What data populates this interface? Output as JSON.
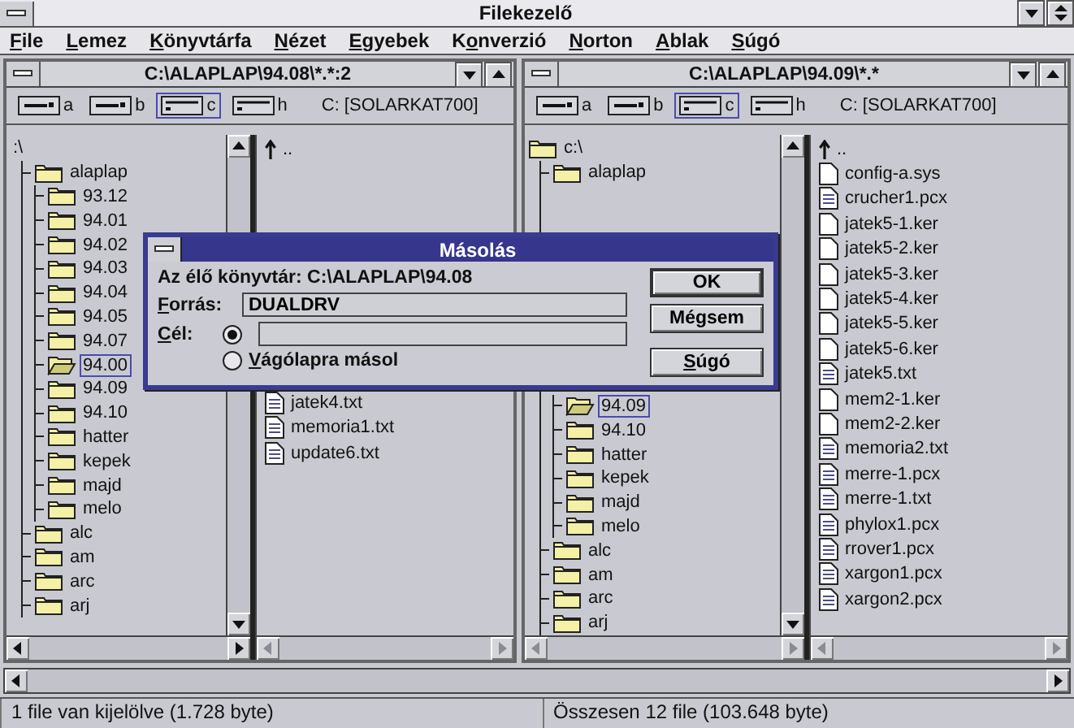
{
  "window": {
    "title": "Filekezelő"
  },
  "menu": [
    {
      "key": "F",
      "after": "ile"
    },
    {
      "key": "L",
      "after": "emez"
    },
    {
      "key": "K",
      "after": "önyvtárfa"
    },
    {
      "key": "N",
      "after": "ézet"
    },
    {
      "key": "E",
      "after": "gyebek"
    },
    {
      "before": "K",
      "key": "o",
      "after": "nverzió"
    },
    {
      "key": "N",
      "after": "orton"
    },
    {
      "key": "A",
      "after": "blak"
    },
    {
      "key": "S",
      "after": "úgó"
    }
  ],
  "panes": [
    {
      "title": "C:\\ALAPLAP\\94.08\\*.*:2",
      "volume": "C: [SOLARKAT700]",
      "drives": [
        {
          "letter": "a",
          "kind": "floppy",
          "selected": false
        },
        {
          "letter": "b",
          "kind": "floppy",
          "selected": false
        },
        {
          "letter": "c",
          "kind": "hdd",
          "selected": true
        },
        {
          "letter": "h",
          "kind": "hdd",
          "selected": false
        }
      ],
      "tree": [
        {
          "name": ":\\",
          "kind": "label",
          "selected": false,
          "children": [
            {
              "name": "alaplap",
              "kind": "folder",
              "selected": false,
              "children": [
                {
                  "name": "93.12",
                  "kind": "folder",
                  "selected": false
                },
                {
                  "name": "94.01",
                  "kind": "folder",
                  "selected": false
                },
                {
                  "name": "94.02",
                  "kind": "folder",
                  "selected": false
                },
                {
                  "name": "94.03",
                  "kind": "folder",
                  "selected": false
                },
                {
                  "name": "94.04",
                  "kind": "folder",
                  "selected": false
                },
                {
                  "name": "94.05",
                  "kind": "folder",
                  "selected": false
                },
                {
                  "name": "94.07",
                  "kind": "folder",
                  "selected": false
                },
                {
                  "name": "94.00",
                  "kind": "folder",
                  "selected": true
                },
                {
                  "name": "94.09",
                  "kind": "folder",
                  "selected": false
                },
                {
                  "name": "94.10",
                  "kind": "folder",
                  "selected": false
                },
                {
                  "name": "hatter",
                  "kind": "folder",
                  "selected": false
                },
                {
                  "name": "kepek",
                  "kind": "folder",
                  "selected": false
                },
                {
                  "name": "majd",
                  "kind": "folder",
                  "selected": false
                },
                {
                  "name": "melo",
                  "kind": "folder",
                  "selected": false
                }
              ]
            },
            {
              "name": "alc",
              "kind": "folder",
              "selected": false
            },
            {
              "name": "am",
              "kind": "folder",
              "selected": false
            },
            {
              "name": "arc",
              "kind": "folder",
              "selected": false
            },
            {
              "name": "arj",
              "kind": "folder",
              "selected": false
            }
          ]
        }
      ],
      "files": [
        {
          "name": "..",
          "kind": "parent",
          "selected": false
        },
        {
          "name": "jatek4.txt",
          "kind": "text",
          "selected": false
        },
        {
          "name": "memoria1.txt",
          "kind": "text",
          "selected": false
        },
        {
          "name": "update6.txt",
          "kind": "text",
          "selected": false
        }
      ]
    },
    {
      "title": "C:\\ALAPLAP\\94.09\\*.*",
      "volume": "C: [SOLARKAT700]",
      "drives": [
        {
          "letter": "a",
          "kind": "floppy",
          "selected": false
        },
        {
          "letter": "b",
          "kind": "floppy",
          "selected": false
        },
        {
          "letter": "c",
          "kind": "hdd",
          "selected": true
        },
        {
          "letter": "h",
          "kind": "hdd",
          "selected": false
        }
      ],
      "tree": [
        {
          "name": "c:\\",
          "kind": "folder",
          "selected": false,
          "children": [
            {
              "name": "alaplap",
              "kind": "folder",
              "selected": false,
              "children": [
                {
                  "name": "94.09",
                  "kind": "folder",
                  "selected": true
                },
                {
                  "name": "94.10",
                  "kind": "folder",
                  "selected": false
                },
                {
                  "name": "hatter",
                  "kind": "folder",
                  "selected": false
                },
                {
                  "name": "kepek",
                  "kind": "folder",
                  "selected": false
                },
                {
                  "name": "majd",
                  "kind": "folder",
                  "selected": false
                },
                {
                  "name": "melo",
                  "kind": "folder",
                  "selected": false
                }
              ]
            },
            {
              "name": "alc",
              "kind": "folder",
              "selected": false
            },
            {
              "name": "am",
              "kind": "folder",
              "selected": false
            },
            {
              "name": "arc",
              "kind": "folder",
              "selected": false
            },
            {
              "name": "arj",
              "kind": "folder",
              "selected": false
            }
          ]
        }
      ],
      "files": [
        {
          "name": "..",
          "kind": "parent",
          "selected": false
        },
        {
          "name": "config-a.sys",
          "kind": "blank",
          "selected": false
        },
        {
          "name": "crucher1.pcx",
          "kind": "text",
          "selected": false
        },
        {
          "name": "jatek5-1.ker",
          "kind": "blank",
          "selected": false
        },
        {
          "name": "jatek5-2.ker",
          "kind": "blank",
          "selected": false
        },
        {
          "name": "jatek5-3.ker",
          "kind": "blank",
          "selected": false
        },
        {
          "name": "jatek5-4.ker",
          "kind": "blank",
          "selected": false
        },
        {
          "name": "jatek5-5.ker",
          "kind": "blank",
          "selected": false
        },
        {
          "name": "jatek5-6.ker",
          "kind": "blank",
          "selected": false
        },
        {
          "name": "jatek5.txt",
          "kind": "text",
          "selected": false
        },
        {
          "name": "mem2-1.ker",
          "kind": "blank",
          "selected": false
        },
        {
          "name": "mem2-2.ker",
          "kind": "blank",
          "selected": false
        },
        {
          "name": "memoria2.txt",
          "kind": "text",
          "selected": false
        },
        {
          "name": "merre-1.pcx",
          "kind": "text",
          "selected": false
        },
        {
          "name": "merre-1.txt",
          "kind": "text",
          "selected": false
        },
        {
          "name": "phylox1.pcx",
          "kind": "text",
          "selected": false
        },
        {
          "name": "rrover1.pcx",
          "kind": "text",
          "selected": false
        },
        {
          "name": "xargon1.pcx",
          "kind": "text",
          "selected": false
        },
        {
          "name": "xargon2.pcx",
          "kind": "text",
          "selected": false
        }
      ]
    }
  ],
  "dialog": {
    "title": "Másolás",
    "current_dir": "Az élő könyvtár: C:\\ALAPLAP\\94.08",
    "source": {
      "label": {
        "key": "F",
        "after": "orrás:"
      },
      "value": "DUALDRV"
    },
    "target": {
      "label": {
        "key": "C",
        "after": "él:"
      },
      "selected": true
    },
    "clipboard": {
      "label": {
        "key": "V",
        "after": "ágólapra másol"
      },
      "selected": false
    },
    "buttons": [
      {
        "label": {
          "after": "OK"
        },
        "default": true
      },
      {
        "label": {
          "after": "Mégsem"
        },
        "default": false
      },
      {
        "label": {
          "key": "S",
          "after": "úgó"
        },
        "default": false
      }
    ]
  },
  "status_bar": [
    "1 file van kijelölve (1.728 byte)",
    "Összesen 12 file (103.648 byte)"
  ]
}
